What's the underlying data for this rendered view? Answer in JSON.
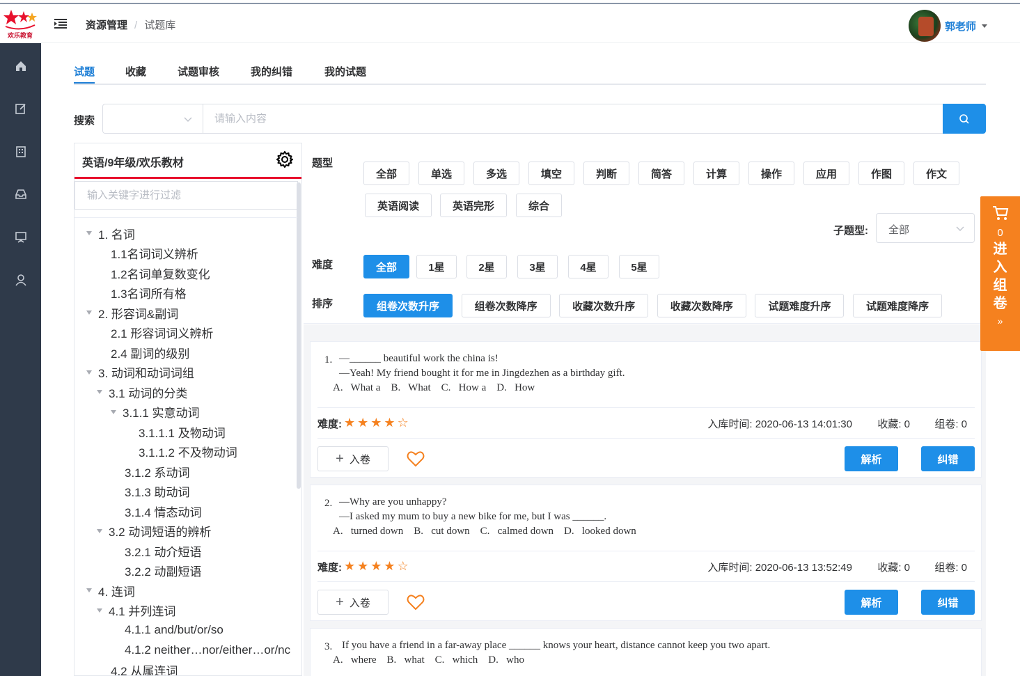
{
  "header": {
    "logo_text": "欢乐教育",
    "breadcrumb": [
      "资源管理",
      "试题库"
    ],
    "breadcrumb_sep": "/",
    "user_name": "郭老师"
  },
  "sidebar": {
    "items": [
      "home-icon",
      "edit-icon",
      "building-icon",
      "inbox-icon",
      "presentation-icon",
      "user-icon"
    ]
  },
  "tabs": [
    "试题",
    "收藏",
    "试题审核",
    "我的纠错",
    "我的试题"
  ],
  "active_tab": 0,
  "search": {
    "label": "搜索",
    "select_value": "",
    "placeholder": "请输入内容",
    "value": ""
  },
  "tree": {
    "title": "英语/9年级/欢乐教材",
    "filter_placeholder": "输入关键字进行过滤",
    "nodes": [
      {
        "label": "1. 名词",
        "level": 0,
        "expanded": true
      },
      {
        "label": "1.1名词词义辨析",
        "level": 1,
        "expanded": false
      },
      {
        "label": "1.2名词单复数变化",
        "level": 1,
        "expanded": false
      },
      {
        "label": "1.3名词所有格",
        "level": 1,
        "expanded": false
      },
      {
        "label": "2. 形容词&副词",
        "level": 0,
        "expanded": true
      },
      {
        "label": "2.1 形容词词义辨析",
        "level": 1,
        "expanded": false
      },
      {
        "label": "2.4 副词的级别",
        "level": 1,
        "expanded": false
      },
      {
        "label": "3. 动词和动词词组",
        "level": 0,
        "expanded": true
      },
      {
        "label": "3.1 动词的分类",
        "level": 1,
        "expanded": true
      },
      {
        "label": "3.1.1 实意动词",
        "level": 2,
        "expanded": true
      },
      {
        "label": "3.1.1.1 及物动词",
        "level": 3,
        "expanded": false
      },
      {
        "label": "3.1.1.2 不及物动词",
        "level": 3,
        "expanded": false
      },
      {
        "label": "3.1.2 系动词",
        "level": 2,
        "expanded": false
      },
      {
        "label": "3.1.3 助动词",
        "level": 2,
        "expanded": false
      },
      {
        "label": "3.1.4 情态动词",
        "level": 2,
        "expanded": false
      },
      {
        "label": "3.2 动词短语的辨析",
        "level": 1,
        "expanded": true
      },
      {
        "label": "3.2.1 动介短语",
        "level": 2,
        "expanded": false
      },
      {
        "label": "3.2.2 动副短语",
        "level": 2,
        "expanded": false
      },
      {
        "label": "4. 连词",
        "level": 0,
        "expanded": true
      },
      {
        "label": "4.1 并列连词",
        "level": 1,
        "expanded": true
      },
      {
        "label": "4.1.1 and/but/or/so",
        "level": 2,
        "expanded": false
      },
      {
        "label": "4.1.2 neither…nor/either…or/nc",
        "level": 2,
        "expanded": false
      },
      {
        "label": "4.2 从属连词",
        "level": 1,
        "expanded": true
      }
    ]
  },
  "filters": {
    "type_label": "题型",
    "types": [
      "全部",
      "单选",
      "多选",
      "填空",
      "判断",
      "简答",
      "计算",
      "操作",
      "应用",
      "作图",
      "作文",
      "英语阅读",
      "英语完形",
      "综合"
    ],
    "subtype_label": "子题型:",
    "subtype_value": "全部",
    "difficulty_label": "难度",
    "difficulties": [
      "全部",
      "1星",
      "2星",
      "3星",
      "4星",
      "5星"
    ],
    "difficulty_active": 0,
    "sort_label": "排序",
    "sorts": [
      "组卷次数升序",
      "组卷次数降序",
      "收藏次数升序",
      "收藏次数降序",
      "试题难度升序",
      "试题难度降序"
    ],
    "sort_active": 0
  },
  "questions": [
    {
      "num": "1.",
      "lines": [
        "—______ beautiful work the china is!",
        "—Yeah! My friend bought it for me in Jingdezhen as a birthday gift."
      ],
      "options": "A.   What a    B.   What    C.   How a    D.   How",
      "difficulty_label": "难度:",
      "stars": 4,
      "stars_total": 5,
      "time": "入库时间: 2020-06-13 14:01:30",
      "fav": "收藏: 0",
      "used": "组卷: 0",
      "add_label": "入卷",
      "analysis_label": "解析",
      "correct_label": "纠错"
    },
    {
      "num": "2.",
      "lines": [
        "—Why are you unhappy?",
        "—I asked my mum to buy a new bike for me, but I was ______."
      ],
      "options": "A.   turned down    B.   cut down    C.   calmed down    D.   looked down",
      "difficulty_label": "难度:",
      "stars": 4,
      "stars_total": 5,
      "time": "入库时间: 2020-06-13 13:52:49",
      "fav": "收藏: 0",
      "used": "组卷: 0",
      "add_label": "入卷",
      "analysis_label": "解析",
      "correct_label": "纠错"
    },
    {
      "num": "3.",
      "lines": [
        "If you have a friend in a far-away place ______ knows your heart, distance cannot keep you two apart."
      ],
      "options": "A.   where    B.   what    C.   which    D.   who"
    }
  ],
  "cart": {
    "count": "0",
    "label": "进入组卷",
    "arrow": "»"
  },
  "colors": {
    "primary": "#1e8fe8",
    "sidebar": "#2f3a4a",
    "accent_orange": "#f5811f",
    "tree_underline": "#e8112d"
  }
}
